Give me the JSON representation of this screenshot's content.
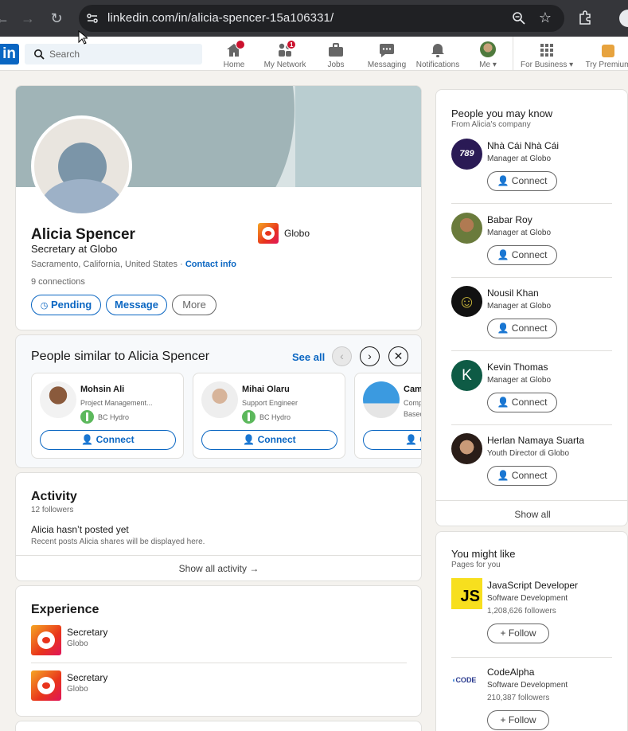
{
  "browser": {
    "url": "linkedin.com/in/alicia-spencer-15a106331/"
  },
  "nav": {
    "search_placeholder": "Search",
    "items": [
      {
        "label": "Home",
        "badge": "•"
      },
      {
        "label": "My Network",
        "badge": "1"
      },
      {
        "label": "Jobs"
      },
      {
        "label": "Messaging"
      },
      {
        "label": "Notifications"
      },
      {
        "label": "Me"
      },
      {
        "label": "For Business"
      },
      {
        "label": "Try Premium"
      }
    ]
  },
  "profile": {
    "name": "Alicia Spencer",
    "headline": "Secretary at Globo",
    "location": "Sacramento, California, United States",
    "contact_info": "Contact info",
    "connections": "9 connections",
    "company": "Globo",
    "buttons": {
      "pending": "Pending",
      "message": "Message",
      "more": "More"
    }
  },
  "similar": {
    "title": "People similar to Alicia Spencer",
    "see_all": "See all",
    "people": [
      {
        "name": "Mohsin Ali",
        "headline": "Project Management...",
        "company": "BC Hydro",
        "connect": "Connect"
      },
      {
        "name": "Mihai Olaru",
        "headline": "Support Engineer",
        "company": "BC Hydro",
        "connect": "Connect"
      },
      {
        "name": "Cam",
        "headline": "Comp",
        "company": "Basec",
        "connect": "C"
      }
    ]
  },
  "activity": {
    "title": "Activity",
    "followers": "12 followers",
    "empty_title": "Alicia hasn’t posted yet",
    "empty_desc": "Recent posts Alicia shares will be displayed here.",
    "show_all": "Show all activity →"
  },
  "experience": {
    "title": "Experience",
    "items": [
      {
        "title": "Secretary",
        "company": "Globo"
      },
      {
        "title": "Secretary",
        "company": "Globo"
      }
    ]
  },
  "pymk": {
    "title": "People you may know",
    "subtitle": "From Alicia's company",
    "people": [
      {
        "name": "Nhà Cái Nhà Cái",
        "headline": "Manager at Globo",
        "connect": "Connect"
      },
      {
        "name": "Babar Roy",
        "headline": "Manager at Globo",
        "connect": "Connect"
      },
      {
        "name": "Nousil Khan",
        "headline": "Manager at Globo",
        "connect": "Connect"
      },
      {
        "name": "Kevin Thomas",
        "headline": "Manager at Globo",
        "connect": "Connect",
        "initial": "K"
      },
      {
        "name": "Herlan Namaya Suarta",
        "headline": "Youth Director di Globo",
        "connect": "Connect"
      }
    ],
    "show_all": "Show all"
  },
  "might_like": {
    "title": "You might like",
    "subtitle": "Pages for you",
    "pages": [
      {
        "name": "JavaScript Developer",
        "industry": "Software Development",
        "followers": "1,208,626 followers",
        "follow": "Follow",
        "logo_text": "JS"
      },
      {
        "name": "CodeAlpha",
        "industry": "Software Development",
        "followers": "210,387 followers",
        "follow": "Follow",
        "logo_text": "CODE"
      }
    ]
  }
}
